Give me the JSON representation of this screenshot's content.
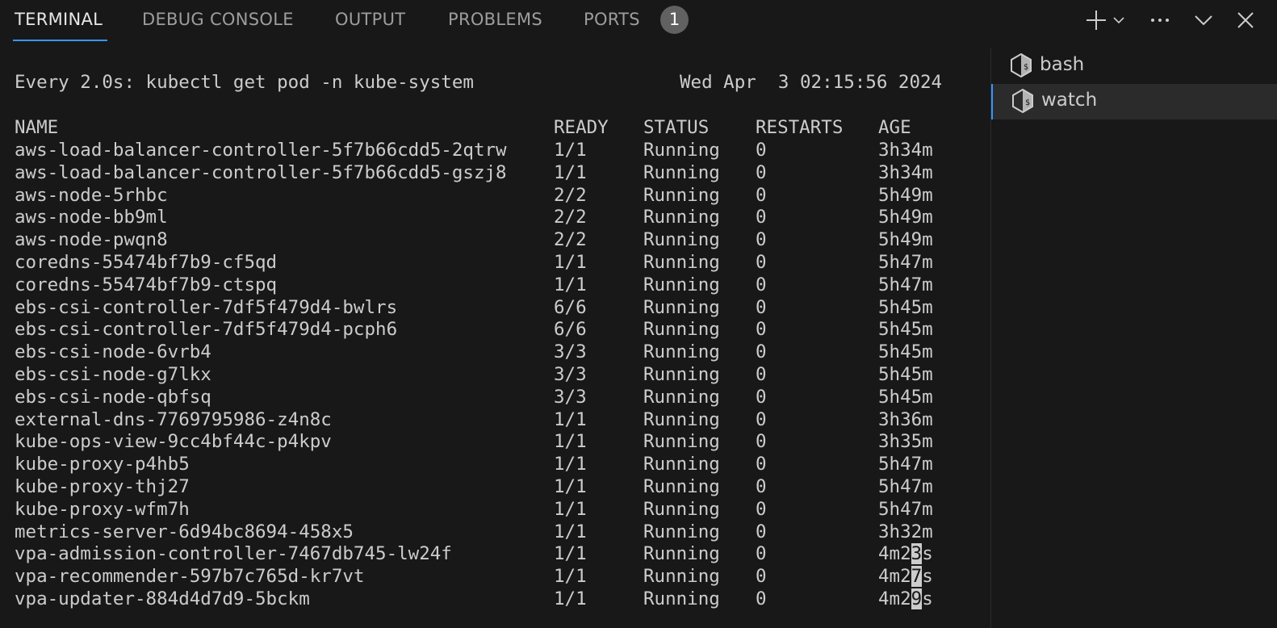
{
  "tabs": [
    {
      "label": "TERMINAL",
      "active": true
    },
    {
      "label": "DEBUG CONSOLE",
      "active": false
    },
    {
      "label": "OUTPUT",
      "active": false
    },
    {
      "label": "PROBLEMS",
      "active": false
    },
    {
      "label": "PORTS",
      "active": false
    }
  ],
  "ports_badge": "1",
  "actions": {
    "icons": [
      "plus-icon",
      "chevron-down-icon",
      "ellipsis-icon",
      "chevron-down-icon",
      "close-icon"
    ]
  },
  "terminal": {
    "watch_header": "Every 2.0s: kubectl get pod -n kube-system",
    "timestamp": "Wed Apr  3 02:15:56 2024",
    "columns": [
      "NAME",
      "READY",
      "STATUS",
      "RESTARTS",
      "AGE"
    ],
    "rows": [
      [
        "aws-load-balancer-controller-5f7b66cdd5-2qtrw",
        "1/1",
        "Running",
        "0",
        "3h34m"
      ],
      [
        "aws-load-balancer-controller-5f7b66cdd5-gszj8",
        "1/1",
        "Running",
        "0",
        "3h34m"
      ],
      [
        "aws-node-5rhbc",
        "2/2",
        "Running",
        "0",
        "5h49m"
      ],
      [
        "aws-node-bb9ml",
        "2/2",
        "Running",
        "0",
        "5h49m"
      ],
      [
        "aws-node-pwqn8",
        "2/2",
        "Running",
        "0",
        "5h49m"
      ],
      [
        "coredns-55474bf7b9-cf5qd",
        "1/1",
        "Running",
        "0",
        "5h47m"
      ],
      [
        "coredns-55474bf7b9-ctspq",
        "1/1",
        "Running",
        "0",
        "5h47m"
      ],
      [
        "ebs-csi-controller-7df5f479d4-bwlrs",
        "6/6",
        "Running",
        "0",
        "5h45m"
      ],
      [
        "ebs-csi-controller-7df5f479d4-pcph6",
        "6/6",
        "Running",
        "0",
        "5h45m"
      ],
      [
        "ebs-csi-node-6vrb4",
        "3/3",
        "Running",
        "0",
        "5h45m"
      ],
      [
        "ebs-csi-node-g7lkx",
        "3/3",
        "Running",
        "0",
        "5h45m"
      ],
      [
        "ebs-csi-node-qbfsq",
        "3/3",
        "Running",
        "0",
        "5h45m"
      ],
      [
        "external-dns-7769795986-z4n8c",
        "1/1",
        "Running",
        "0",
        "3h36m"
      ],
      [
        "kube-ops-view-9cc4bf44c-p4kpv",
        "1/1",
        "Running",
        "0",
        "3h35m"
      ],
      [
        "kube-proxy-p4hb5",
        "1/1",
        "Running",
        "0",
        "5h47m"
      ],
      [
        "kube-proxy-thj27",
        "1/1",
        "Running",
        "0",
        "5h47m"
      ],
      [
        "kube-proxy-wfm7h",
        "1/1",
        "Running",
        "0",
        "5h47m"
      ],
      [
        "metrics-server-6d94bc8694-458x5",
        "1/1",
        "Running",
        "0",
        "3h32m"
      ],
      [
        "vpa-admission-controller-7467db745-lw24f",
        "1/1",
        "Running",
        "0",
        "4m23s"
      ],
      [
        "vpa-recommender-597b7c765d-kr7vt",
        "1/1",
        "Running",
        "0",
        "4m27s"
      ],
      [
        "vpa-updater-884d4d7d9-5bckm",
        "1/1",
        "Running",
        "0",
        "4m29s"
      ]
    ]
  },
  "shells": [
    {
      "label": "bash",
      "active": false,
      "icon": "terminal-bash-icon"
    },
    {
      "label": "watch",
      "active": true,
      "icon": "terminal-bash-icon"
    }
  ],
  "colors": {
    "background": "#181818",
    "text": "#cccccc",
    "accent": "#3794ff",
    "badge": "#616161"
  }
}
